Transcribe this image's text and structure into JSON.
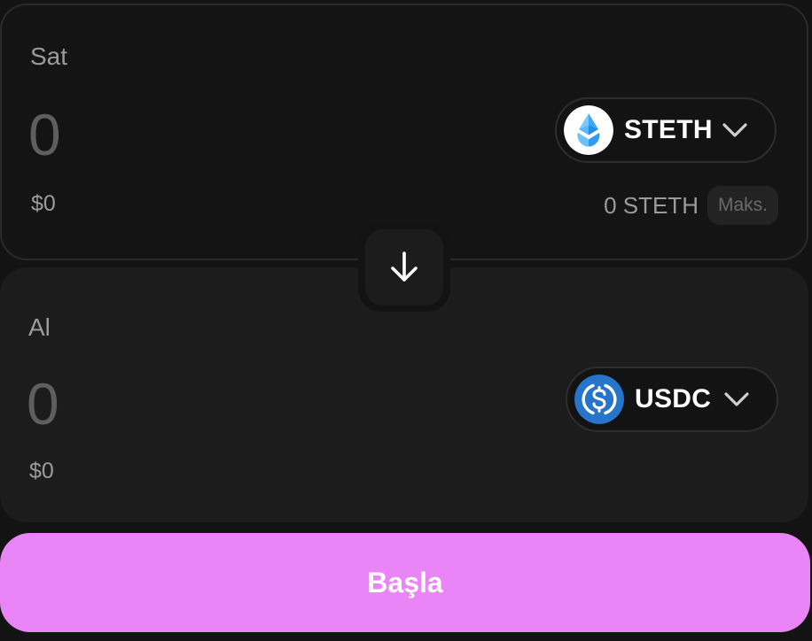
{
  "sell": {
    "label": "Sat",
    "amount_placeholder": "0",
    "usd_value": "$0",
    "token": {
      "symbol": "STETH",
      "icon": "steth-token-icon",
      "icon_color": "#00a3ff"
    },
    "balance": "0 STETH",
    "max_label": "Maks."
  },
  "buy": {
    "label": "Al",
    "amount_placeholder": "0",
    "usd_value": "$0",
    "token": {
      "symbol": "USDC",
      "icon": "usdc-token-icon",
      "icon_color": "#2775ca"
    }
  },
  "swap_direction": {
    "icon": "arrow-down-icon"
  },
  "primary_action": {
    "label": "Başla",
    "color": "#ea85f7"
  },
  "colors": {
    "background": "#131313",
    "panel_sell": "#141414",
    "panel_buy": "#1c1c1c",
    "muted_text": "#9b9b9b"
  }
}
